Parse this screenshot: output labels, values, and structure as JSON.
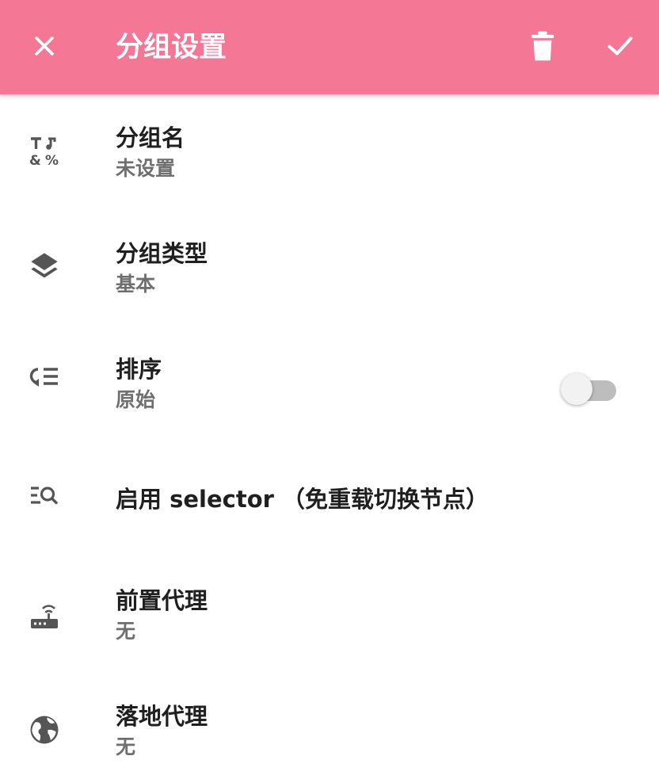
{
  "toolbar": {
    "title": "分组设置",
    "close_icon": "close-icon",
    "delete_icon": "trash-icon",
    "confirm_icon": "check-icon",
    "background_color": "#f47896"
  },
  "settings": [
    {
      "id": "group-name",
      "icon": "text-symbols-icon",
      "title": "分组名",
      "subtitle": "未设置"
    },
    {
      "id": "group-type",
      "icon": "layers-icon",
      "title": "分组类型",
      "subtitle": "基本"
    },
    {
      "id": "sort",
      "icon": "sort-icon",
      "title": "排序",
      "subtitle": "原始"
    },
    {
      "id": "selector",
      "icon": "list-search-icon",
      "title": "启用 selector （免重载切换节点）",
      "toggle": false
    },
    {
      "id": "front-proxy",
      "icon": "router-icon",
      "title": "前置代理",
      "subtitle": "无"
    },
    {
      "id": "landing-proxy",
      "icon": "globe-icon",
      "title": "落地代理",
      "subtitle": "无"
    }
  ]
}
